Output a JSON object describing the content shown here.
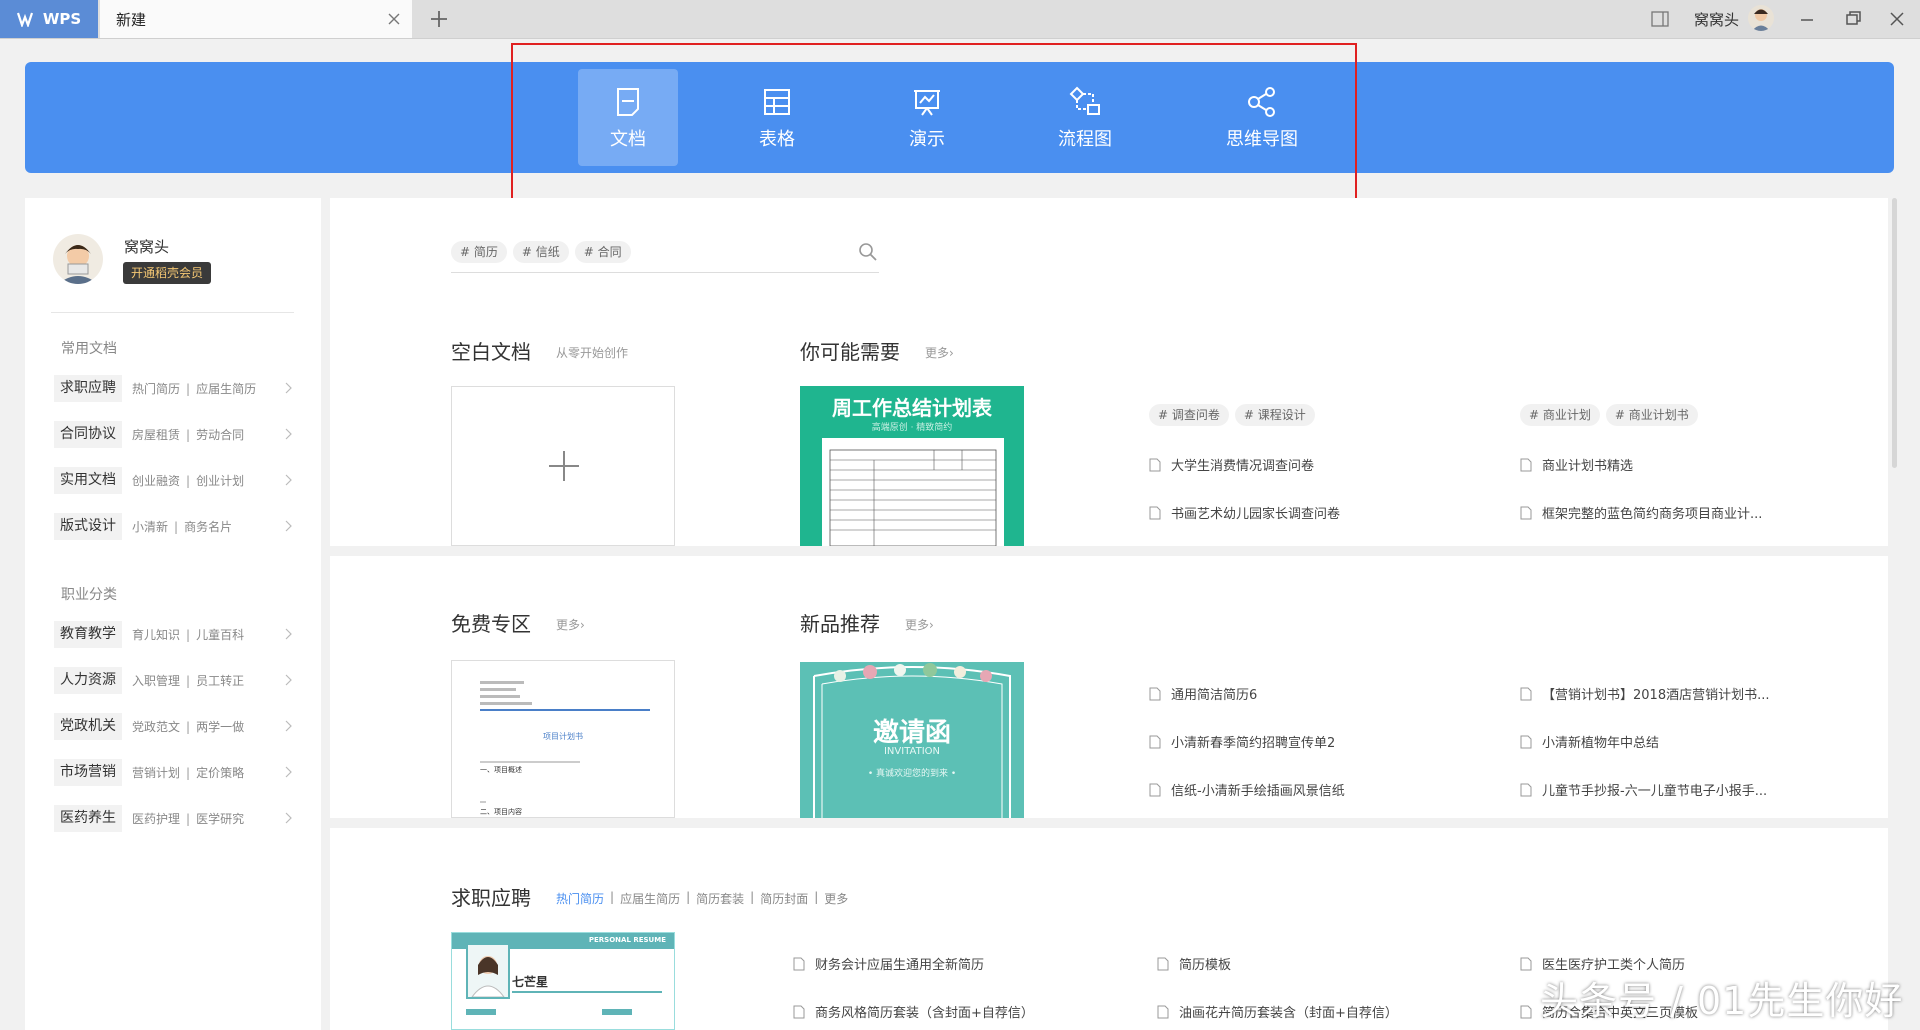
{
  "titlebar": {
    "app_name": "WPS",
    "tab_label": "新建",
    "user_name": "窝窝头"
  },
  "hero": {
    "types": [
      {
        "label": "文档",
        "icon": "document-icon",
        "active": true
      },
      {
        "label": "表格",
        "icon": "table-icon"
      },
      {
        "label": "演示",
        "icon": "presentation-icon"
      },
      {
        "label": "流程图",
        "icon": "flowchart-icon"
      },
      {
        "label": "思维导图",
        "icon": "mindmap-icon"
      }
    ]
  },
  "profile": {
    "name": "窝窝头",
    "vip_label": "开通稻壳会员"
  },
  "left": {
    "common_title": "常用文档",
    "common": [
      {
        "category": "求职应聘",
        "sub1": "热门简历",
        "sub2": "应届生简历"
      },
      {
        "category": "合同协议",
        "sub1": "房屋租赁",
        "sub2": "劳动合同"
      },
      {
        "category": "实用文档",
        "sub1": "创业融资",
        "sub2": "创业计划"
      },
      {
        "category": "版式设计",
        "sub1": "小清新",
        "sub2": "商务名片"
      }
    ],
    "career_title": "职业分类",
    "career": [
      {
        "category": "教育教学",
        "sub1": "育儿知识",
        "sub2": "儿童百科"
      },
      {
        "category": "人力资源",
        "sub1": "入职管理",
        "sub2": "员工转正"
      },
      {
        "category": "党政机关",
        "sub1": "党政范文",
        "sub2": "两学一做"
      },
      {
        "category": "市场营销",
        "sub1": "营销计划",
        "sub2": "定价策略"
      },
      {
        "category": "医药养生",
        "sub1": "医药护理",
        "sub2": "医学研究"
      }
    ],
    "separator": "|"
  },
  "search": {
    "tags": [
      "# 简历",
      "# 信纸",
      "# 合同"
    ]
  },
  "blank": {
    "title": "空白文档",
    "subtitle": "从零开始创作"
  },
  "recommend": {
    "title": "你可能需要",
    "more": "更多›",
    "thumb_title": "周工作总结计划表",
    "thumb_sub": "高端原创 · 精致简约",
    "col1_tags": [
      "# 调查问卷",
      "# 课程设计"
    ],
    "col1_links": [
      "大学生消费情况调查问卷",
      "书画艺术幼儿园家长调查问卷"
    ],
    "col2_tags": [
      "# 商业计划",
      "# 商业计划书"
    ],
    "col2_links": [
      "商业计划书精选",
      "框架完整的蓝色简约商务项目商业计..."
    ]
  },
  "free": {
    "title": "免费专区",
    "more": "更多›",
    "thumb_heading": "项目计划书",
    "thumb_lines": [
      "一、项目概述",
      "二、项目内容"
    ]
  },
  "newest": {
    "title": "新品推荐",
    "more": "更多›",
    "thumb_title": "邀请函",
    "thumb_sub": "INVITATION",
    "thumb_line": "• 真诚欢迎您的到来 •",
    "col1_links": [
      "通用简洁简历6",
      "小清新春季简约招聘宣传单2",
      "信纸-小清新手绘插画风景信纸"
    ],
    "col2_links": [
      "【营销计划书】2018酒店营销计划书...",
      "小清新植物年中总结",
      "儿童节手抄报-六一儿童节电子小报手..."
    ]
  },
  "resume": {
    "title": "求职应聘",
    "filters": [
      "热门简历",
      "应届生简历",
      "简历套装",
      "简历封面",
      "更多"
    ],
    "thumb_header": "PERSONAL RESUME",
    "thumb_name": "七芒星",
    "col1_links": [
      "财务会计应届生通用全新简历",
      "商务风格简历套装（含封面+自荐信）"
    ],
    "col2_links": [
      "简历模板",
      "油画花卉简历套装含（封面+自荐信）"
    ],
    "col3_links": [
      "医生医疗护工类个人简历",
      "简历合集合中英文三页模板"
    ]
  },
  "watermark": "头条号 / 01先生你好",
  "colors": {
    "hero_blue": "#4a8ff0",
    "tab_blue": "#5b8cd6",
    "highlight_red": "#e02020",
    "link_blue": "#4a8ff0"
  }
}
